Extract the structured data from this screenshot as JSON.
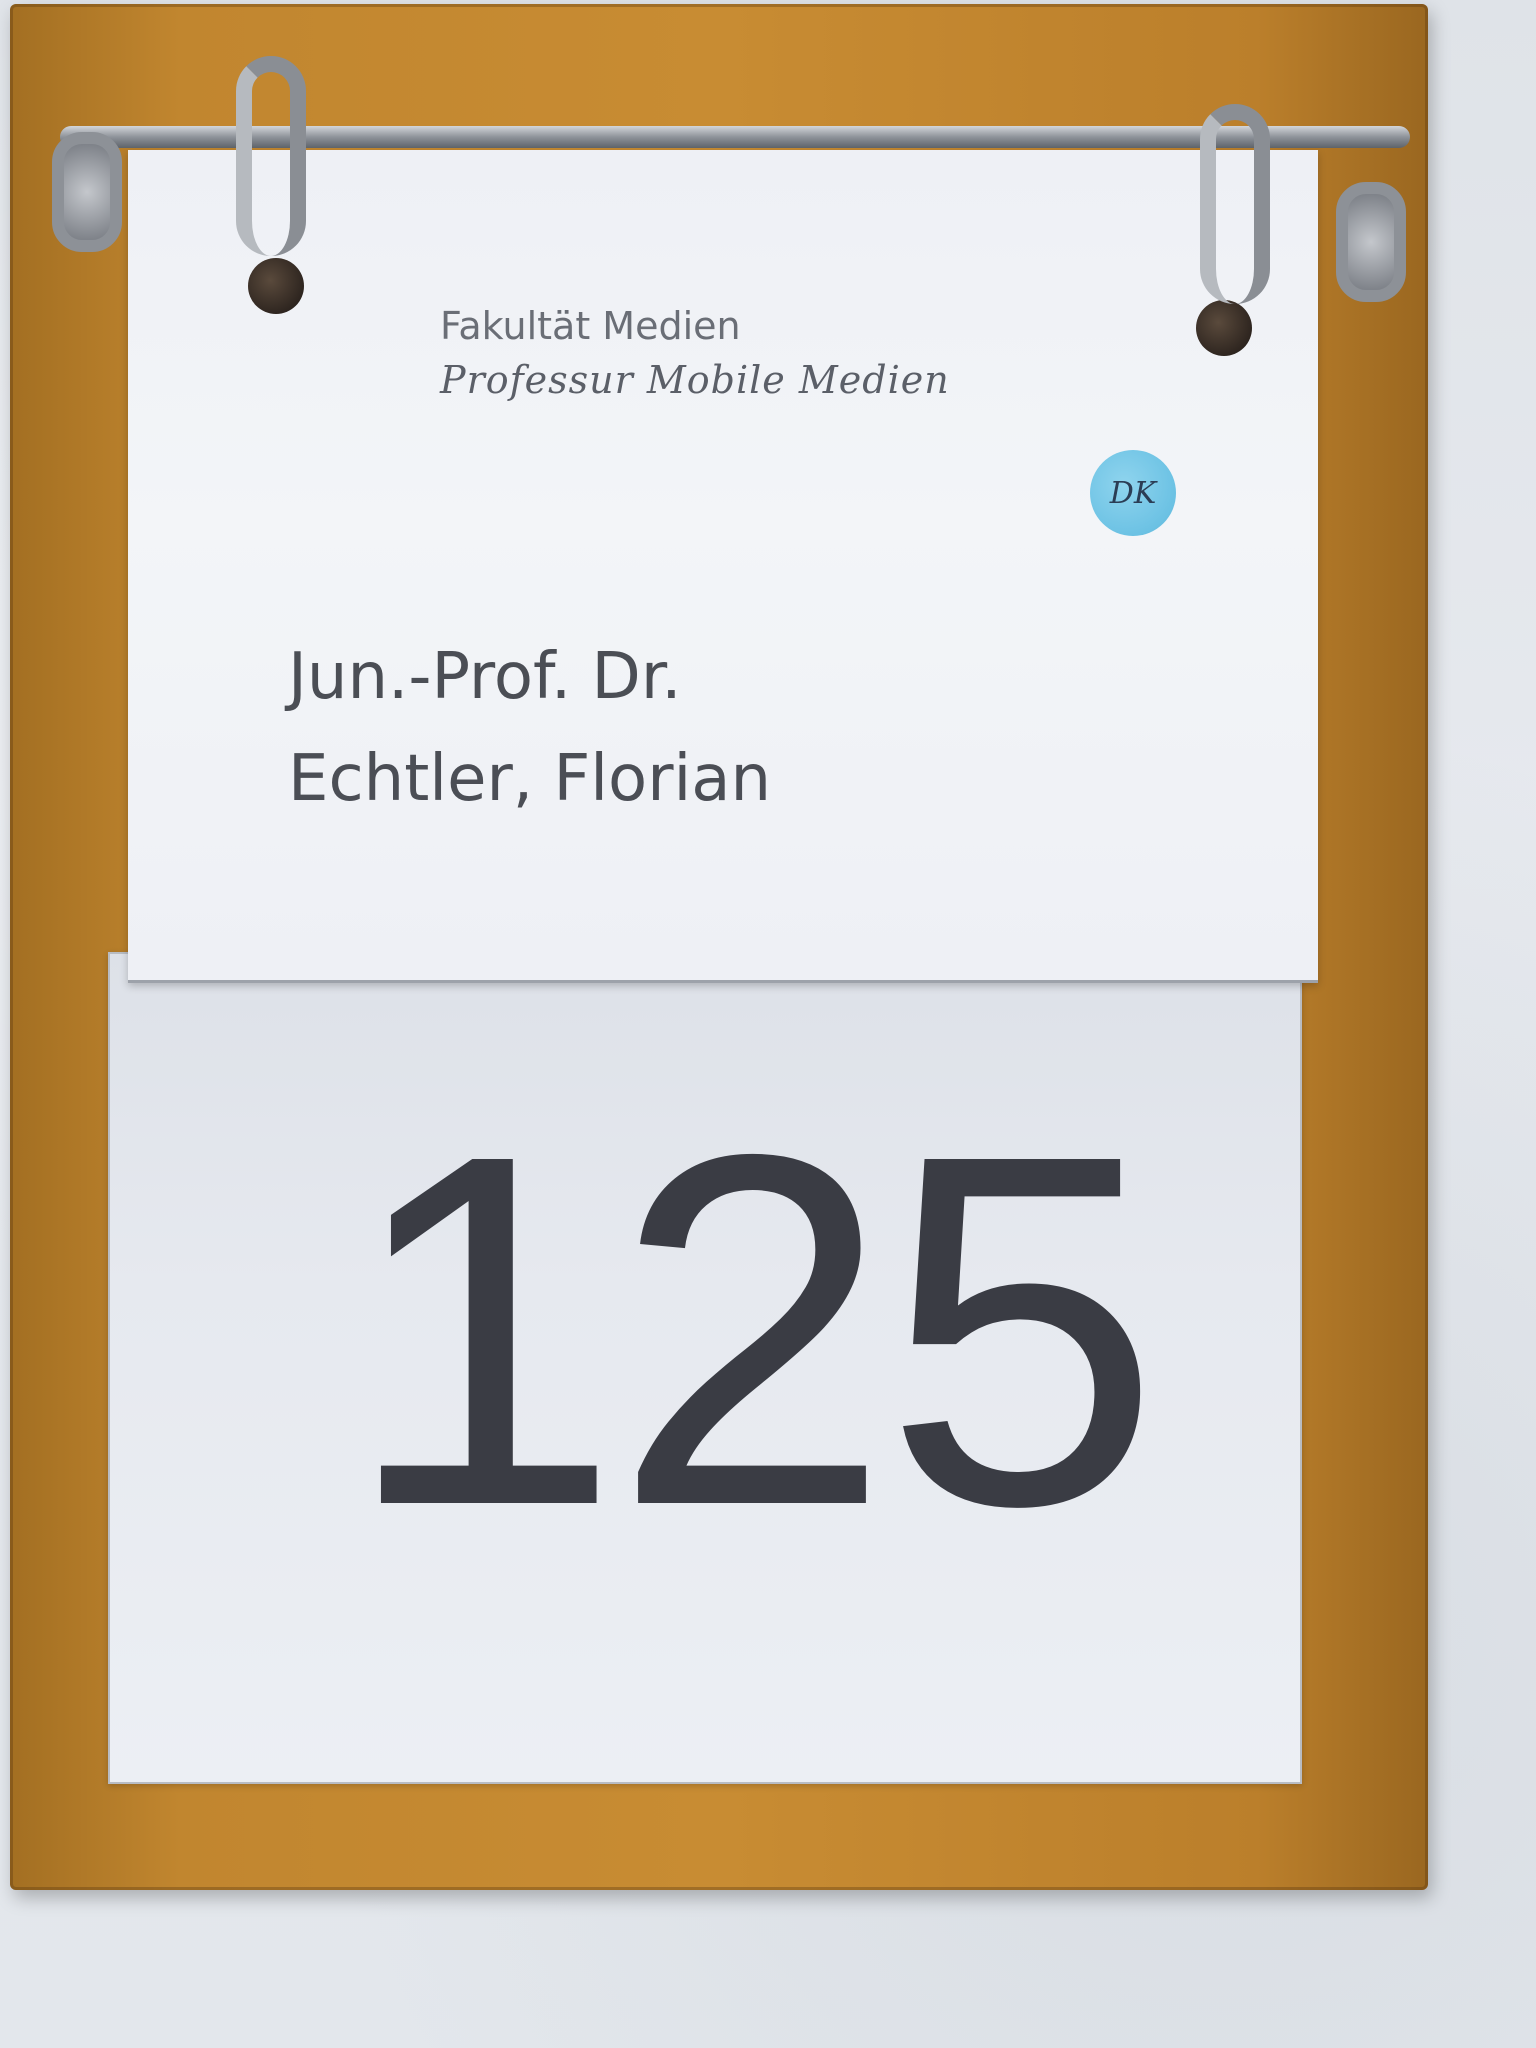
{
  "sign": {
    "faculty": "Fakultät Medien",
    "professorship": "Professur Mobile Medien",
    "name_title": "Jun.-Prof. Dr.",
    "name_person": "Echtler, Florian",
    "sticker_initials": "DK",
    "room_number": "125"
  },
  "colors": {
    "board": "#c88c33",
    "card": "#eef0f5",
    "wall": "#e3e7ec",
    "sticker": "#6cc2e4",
    "text": "#3a3c44"
  }
}
